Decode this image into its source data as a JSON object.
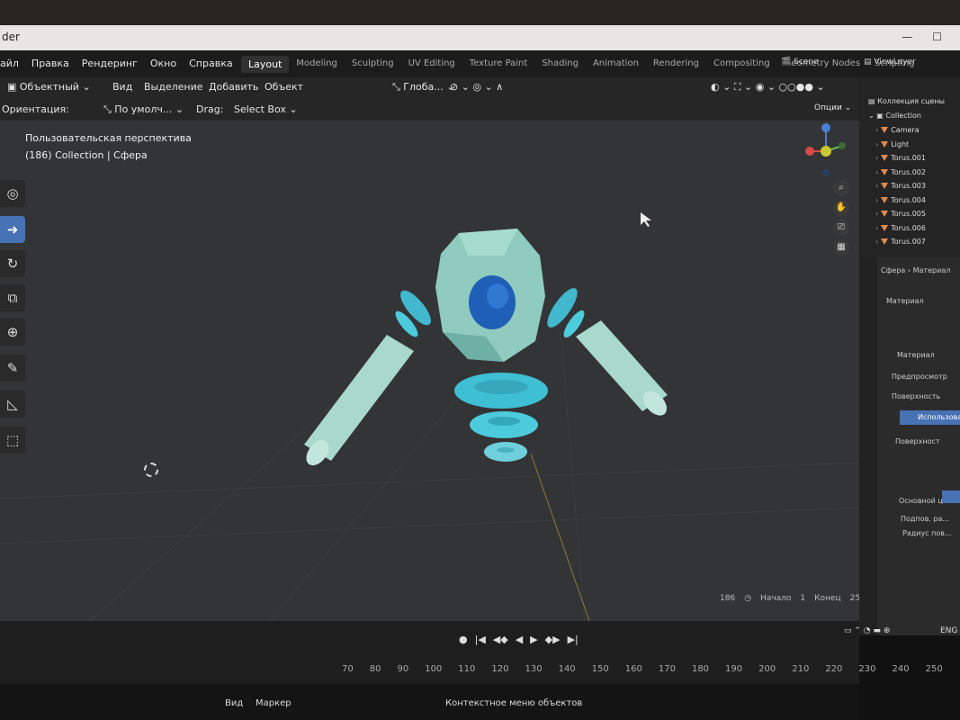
{
  "window": {
    "title_fragment": "der"
  },
  "menu": [
    "айл",
    "Правка",
    "Рендеринг",
    "Окно",
    "Справка"
  ],
  "workspaces": [
    "Layout",
    "Modeling",
    "Sculpting",
    "UV Editing",
    "Texture Paint",
    "Shading",
    "Animation",
    "Rendering",
    "Compositing",
    "Geometry Nodes",
    "Scripting"
  ],
  "active_workspace": "Layout",
  "scene": "Scene",
  "view_layer": "ViewLayer",
  "header": {
    "mode": "Объектный",
    "view": "Вид",
    "select": "Выделение",
    "add": "Добавить",
    "object": "Объект",
    "transform": "Глоба...",
    "orientation_label": "Ориентация:",
    "orientation_value": "По умолч...",
    "drag_label": "Drag:",
    "drag_value": "Select Box",
    "options": "Опции"
  },
  "viewport": {
    "perspective": "Пользовательская перспектива",
    "collection_info": "(186) Collection | Сфера"
  },
  "outliner": {
    "scene_collection": "Коллекция сцены",
    "collection": "Collection",
    "items": [
      "Camera",
      "Light",
      "Torus.001",
      "Torus.002",
      "Torus.003",
      "Torus.004",
      "Torus.005",
      "Torus.006",
      "Torus.007"
    ]
  },
  "properties": {
    "breadcrumb_obj": "Сфера",
    "breadcrumb_mat": "Материал",
    "material_slot": "Материал",
    "material_name": "Материал",
    "preview": "Предпросмотр",
    "surface": "Поверхность",
    "use_nodes": "Использовать",
    "surface_label": "Поверхност",
    "base_color": "Основной ц...",
    "subsurface": "Подпов. ра...",
    "subsurface_radius": "Радиус пов..."
  },
  "timeline": {
    "ticks": [
      "70",
      "80",
      "90",
      "100",
      "110",
      "120",
      "130",
      "140",
      "150",
      "160",
      "170",
      "180",
      "190",
      "200",
      "210",
      "220",
      "230",
      "240",
      "250"
    ],
    "current_frame": "186",
    "start_label": "Начало",
    "start": "1",
    "end_label": "Конец",
    "end": "250",
    "view": "Вид",
    "marker": "Маркер",
    "status": "Контекстное меню объектов"
  },
  "taskbar": {
    "lang": "ENG"
  },
  "colors": {
    "viewport_bg": "#333436",
    "object_teal": "#8fd3c6",
    "eye_blue": "#1f5fb8",
    "torus_cyan": "#4ccbdc",
    "accent": "#4772b3"
  }
}
